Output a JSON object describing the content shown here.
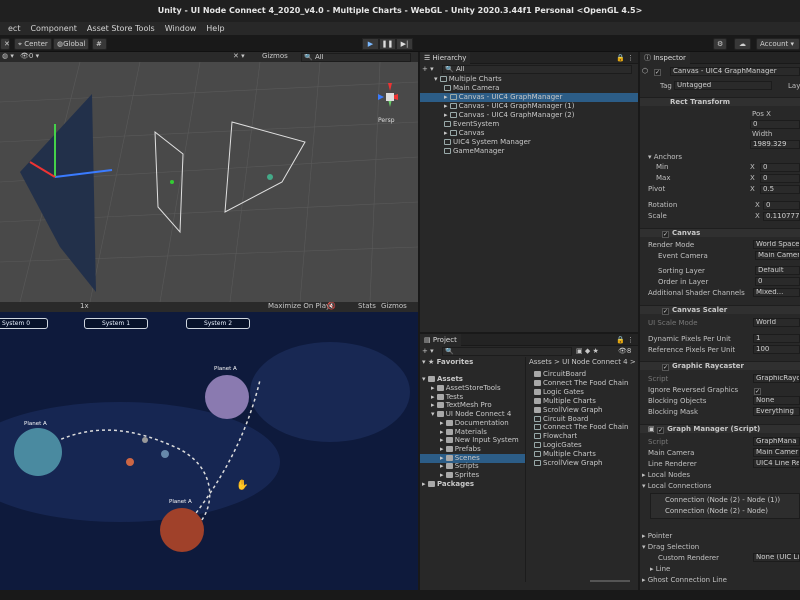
{
  "window": {
    "title": "Unity - UI Node Connect 4_2020_v4.0 - Multiple Charts - WebGL - Unity 2020.3.44f1 Personal <OpenGL 4.5>"
  },
  "menu": [
    "ect",
    "Component",
    "Asset Store Tools",
    "Window",
    "Help"
  ],
  "toolbar": {
    "center": "Center",
    "global": "Global",
    "account": "Account",
    "play_icon": "play-icon",
    "pause_icon": "pause-icon",
    "step_icon": "step-icon"
  },
  "scene": {
    "gizmos": "Gizmos",
    "search": "All",
    "persp": "Persp",
    "zoom": "0"
  },
  "game": {
    "scale": "1x",
    "maximize": "Maximize On Play",
    "stats": "Stats",
    "gizmos": "Gizmos",
    "buttons": [
      "System 0",
      "System 1",
      "System 2"
    ],
    "planets": [
      "Planet A",
      "Planet A",
      "Planet A"
    ]
  },
  "hierarchy": {
    "title": "Hierarchy",
    "search": "All",
    "items": [
      {
        "label": "Multiple Charts",
        "depth": 0,
        "root": true
      },
      {
        "label": "Main Camera",
        "depth": 1
      },
      {
        "label": "Canvas - UIC4 GraphManager",
        "depth": 1,
        "arrow": true,
        "selected": true
      },
      {
        "label": "Canvas - UIC4 GraphManager (1)",
        "depth": 1,
        "arrow": true
      },
      {
        "label": "Canvas - UIC4 GraphManager (2)",
        "depth": 1,
        "arrow": true
      },
      {
        "label": "EventSystem",
        "depth": 1
      },
      {
        "label": "Canvas",
        "depth": 1,
        "arrow": true
      },
      {
        "label": "UIC4 System Manager",
        "depth": 1
      },
      {
        "label": "GameManager",
        "depth": 1
      }
    ]
  },
  "project": {
    "title": "Project",
    "favorites": "Favorites",
    "assets": "Assets",
    "packages": "Packages",
    "breadcrumb": "Assets > UI Node Connect 4 >",
    "count": "8",
    "tree": [
      {
        "label": "AssetStoreTools",
        "depth": 1
      },
      {
        "label": "Tests",
        "depth": 1
      },
      {
        "label": "TextMesh Pro",
        "depth": 1
      },
      {
        "label": "UI Node Connect 4",
        "depth": 1,
        "open": true
      },
      {
        "label": "Documentation",
        "depth": 2
      },
      {
        "label": "Materials",
        "depth": 2
      },
      {
        "label": "New Input System",
        "depth": 2
      },
      {
        "label": "Prefabs",
        "depth": 2
      },
      {
        "label": "Scenes",
        "depth": 2,
        "selected": true
      },
      {
        "label": "Scripts",
        "depth": 2
      },
      {
        "label": "Sprites",
        "depth": 2
      }
    ],
    "files": [
      "CircuitBoard",
      "Connect The Food Chain",
      "Logic Gates",
      "Multiple Charts",
      "ScrollView Graph",
      "Circuit Board",
      "Connect The Food Chain",
      "Flowchart",
      "LogicGates",
      "Multiple Charts",
      "ScrollView Graph"
    ]
  },
  "inspector": {
    "title": "Inspector",
    "object": "Canvas - UIC4 GraphManager",
    "tag_label": "Tag",
    "tag": "Untagged",
    "layer": "Lay",
    "rect": {
      "title": "Rect Transform",
      "posx_label": "Pos X",
      "posx": "0",
      "width_label": "Width",
      "width": "1989.329",
      "anchors": "Anchors",
      "min": "Min",
      "max": "Max",
      "anchor_minx": "0",
      "anchor_maxx": "0",
      "pivot": "Pivot",
      "pivot_x": "0.5",
      "rotation": "Rotation",
      "rot_x": "0",
      "scale": "Scale",
      "scale_x": "0.1107773",
      "x": "X"
    },
    "canvas": {
      "title": "Canvas",
      "render_mode_label": "Render Mode",
      "render_mode": "World Space",
      "event_camera_label": "Event Camera",
      "event_camera": "Main Camer",
      "sorting_layer_label": "Sorting Layer",
      "sorting_layer": "Default",
      "order_label": "Order in Layer",
      "order": "0",
      "shader_label": "Additional Shader Channels",
      "shader": "Mixed..."
    },
    "scaler": {
      "title": "Canvas Scaler",
      "mode_label": "UI Scale Mode",
      "mode": "World",
      "dpu_label": "Dynamic Pixels Per Unit",
      "dpu": "1",
      "rpu_label": "Reference Pixels Per Unit",
      "rpu": "100"
    },
    "raycaster": {
      "title": "Graphic Raycaster",
      "script_label": "Script",
      "script": "GraphicRaycas",
      "ignore_label": "Ignore Reversed Graphics",
      "ignore": "✓",
      "blocking_obj_label": "Blocking Objects",
      "blocking_obj": "None",
      "blocking_mask_label": "Blocking Mask",
      "blocking_mask": "Everything"
    },
    "graph": {
      "title": "Graph Manager (Script)",
      "script_label": "Script",
      "script": "GraphMana",
      "camera_label": "Main Camera",
      "camera": "Main Camer",
      "renderer_label": "Line Renderer",
      "renderer": "UIC4 Line Re",
      "local_nodes": "Local Nodes",
      "local_connections": "Local Connections",
      "conn1": "Connection (Node (2) - Node (1))",
      "conn2": "Connection (Node (2) - Node)",
      "pointer": "Pointer",
      "drag": "Drag Selection",
      "custom_label": "Custom Renderer",
      "custom": "None (UIC Lin",
      "line": "Line",
      "ghost": "Ghost Connection Line"
    }
  }
}
